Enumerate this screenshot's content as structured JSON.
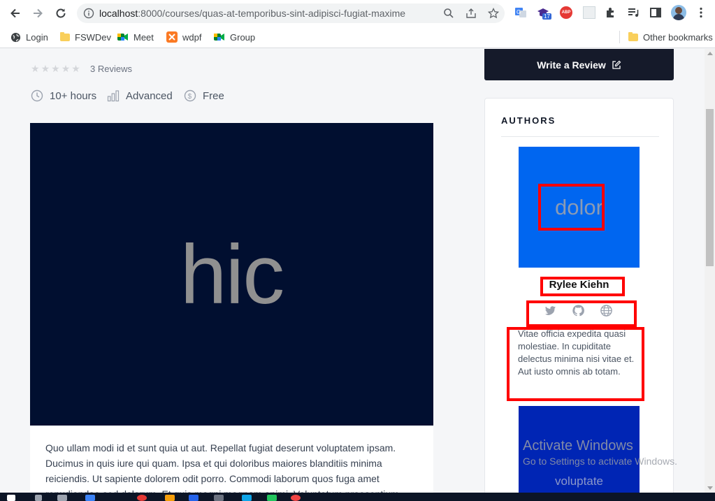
{
  "browser": {
    "url_host": "localhost",
    "url_rest": ":8000/courses/quas-at-temporibus-sint-adipisci-fugiat-maxime",
    "ext_badge": "17",
    "abp_label": "ABP"
  },
  "bookmarks": {
    "items": [
      "Login",
      "FSWDev",
      "Meet",
      "wdpf",
      "Group"
    ],
    "other": "Other bookmarks"
  },
  "course": {
    "reviews": "3 Reviews",
    "duration": "10+ hours",
    "level": "Advanced",
    "price": "Free",
    "thumbnail_text": "hic",
    "description": "Quo ullam modi id et sunt quia ut aut. Repellat fugiat deserunt voluptatem ipsam. Ducimus in quis iure qui quam. Ipsa et qui doloribus maiores blanditiis minima reiciendis. Ut sapiente dolorem odit porro. Commodi laborum quos fuga amet repudiandae sed dolorum. Et quis magni magnam animi. Voluptatum praesentium"
  },
  "sidebar": {
    "write_review": "Write a Review",
    "authors_title": "AUTHORS",
    "author": {
      "image_text": "dolor",
      "name": "Rylee Kiehn",
      "bio": "Vitae officia expedita quasi molestiae. In cupiditate delectus minima nisi vitae et. Aut iusto omnis ab totam."
    },
    "author2_image_text": "voluptate"
  },
  "watermark": {
    "line1": "Activate Windows",
    "line2": "Go to Settings to activate Windows."
  },
  "colors": {
    "thumbnail_bg": "#010f30",
    "author_img_bg": "#0066f0",
    "author2_img_bg": "#0025b4",
    "button_bg": "#151a2a",
    "highlight": "#ff0000"
  },
  "icons": [
    "back-icon",
    "forward-icon",
    "reload-icon",
    "info-icon",
    "zoom-icon",
    "share-icon",
    "star-bookmark-icon",
    "translate-icon",
    "puzzle-icon",
    "media-icon",
    "sidebar-icon",
    "profile-avatar",
    "menu-icon",
    "clock-icon",
    "bar-chart-icon",
    "dollar-icon",
    "edit-icon",
    "twitter-icon",
    "github-icon",
    "globe-icon"
  ]
}
